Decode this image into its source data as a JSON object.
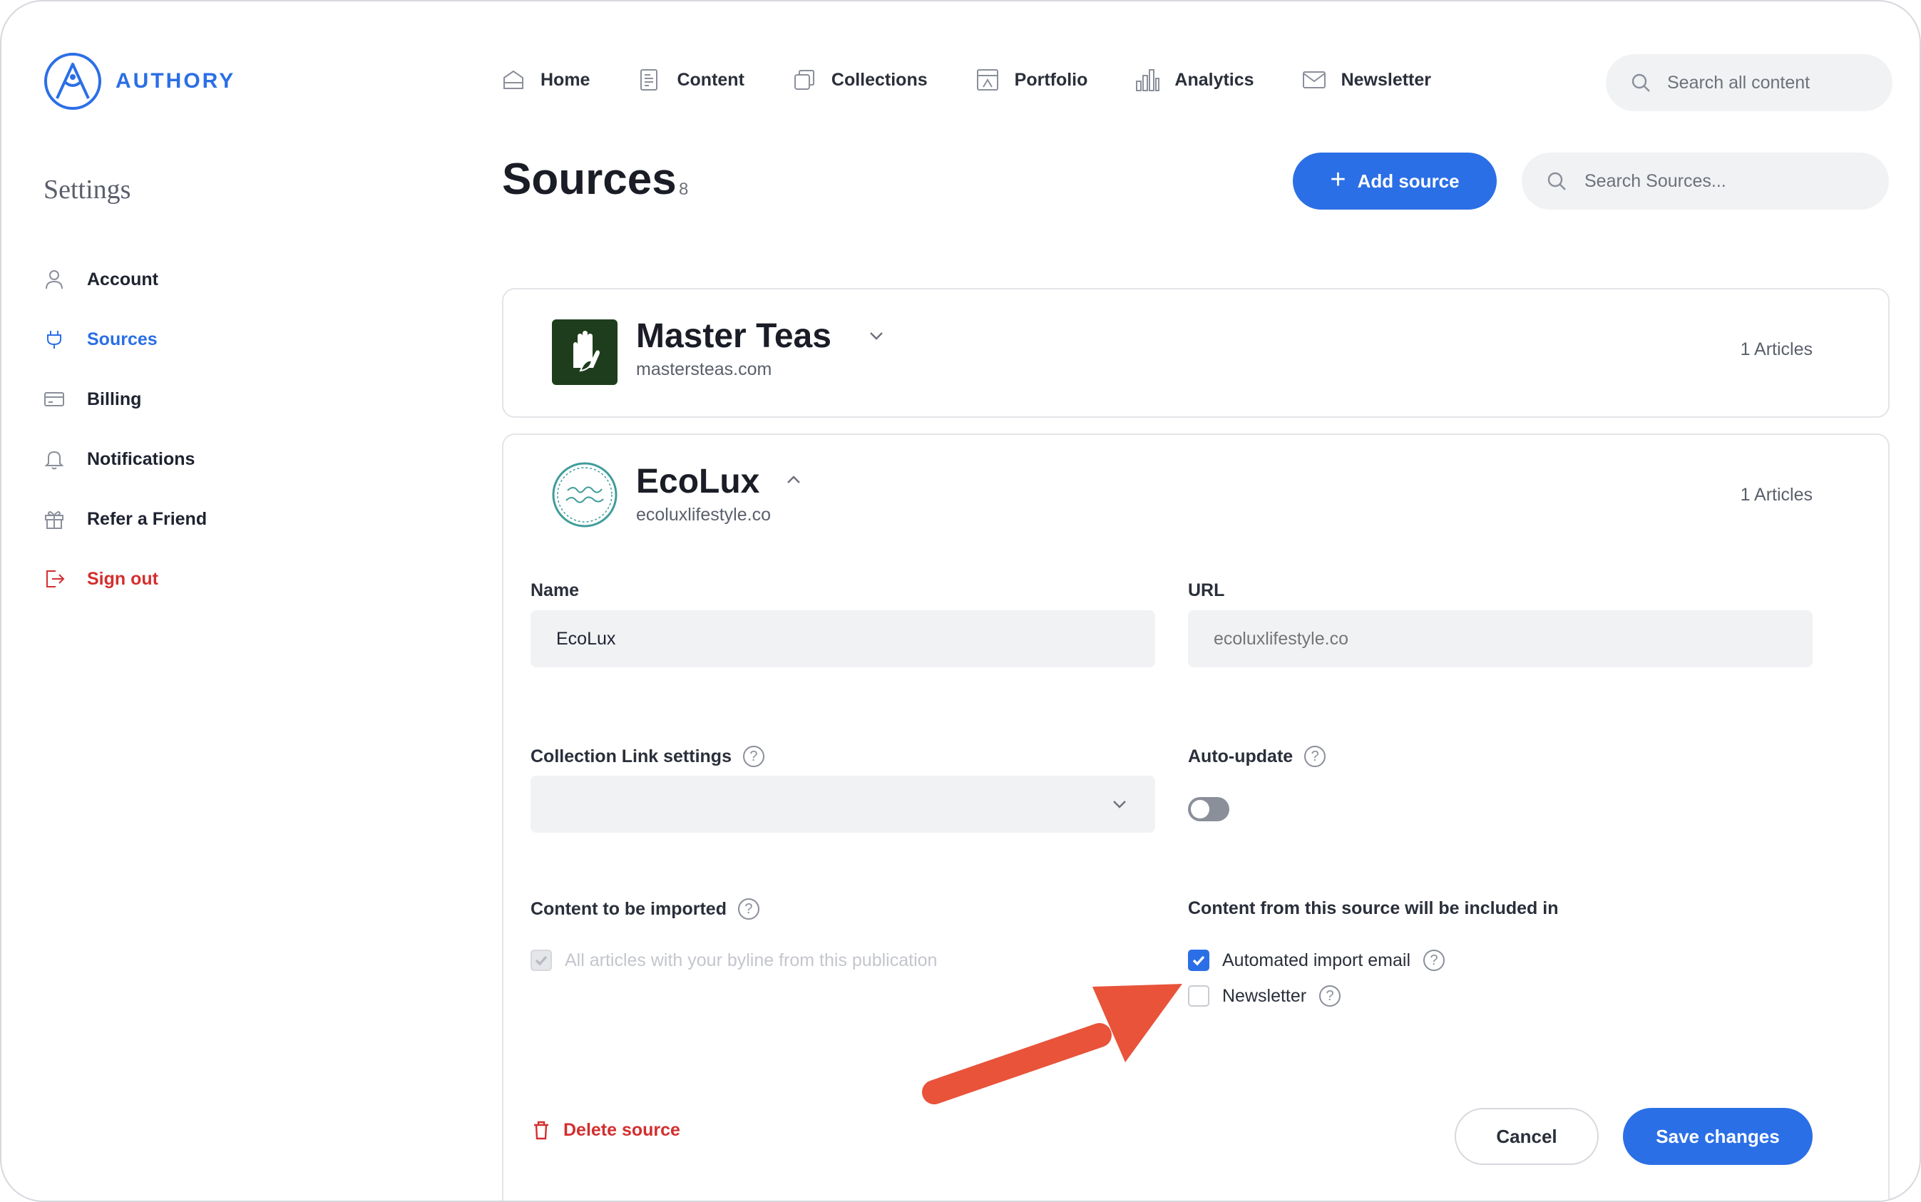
{
  "app": {
    "logo_text": "AUTHORY"
  },
  "topnav": {
    "items": [
      {
        "label": "Home",
        "icon": "home-icon"
      },
      {
        "label": "Content",
        "icon": "document-icon"
      },
      {
        "label": "Collections",
        "icon": "collections-icon"
      },
      {
        "label": "Portfolio",
        "icon": "portfolio-icon"
      },
      {
        "label": "Analytics",
        "icon": "bar-chart-icon"
      },
      {
        "label": "Newsletter",
        "icon": "mail-icon"
      }
    ],
    "search_placeholder": "Search all content"
  },
  "sidebar": {
    "title": "Settings",
    "items": [
      {
        "label": "Account",
        "icon": "user-icon",
        "state": "normal"
      },
      {
        "label": "Sources",
        "icon": "plug-icon",
        "state": "active"
      },
      {
        "label": "Billing",
        "icon": "card-icon",
        "state": "normal"
      },
      {
        "label": "Notifications",
        "icon": "bell-icon",
        "state": "normal"
      },
      {
        "label": "Refer a Friend",
        "icon": "gift-icon",
        "state": "normal"
      },
      {
        "label": "Sign out",
        "icon": "sign-out-icon",
        "state": "danger"
      }
    ]
  },
  "header": {
    "title": "Sources",
    "count": "8",
    "add_label": "Add source",
    "search_placeholder": "Search Sources..."
  },
  "sources": [
    {
      "name": "Master Teas",
      "url": "mastersteas.com",
      "articles": "1 Articles",
      "expanded": false
    },
    {
      "name": "EcoLux",
      "url": "ecoluxlifestyle.co",
      "articles": "1 Articles",
      "expanded": true
    }
  ],
  "edit_form": {
    "name_label": "Name",
    "name_value": "EcoLux",
    "url_label": "URL",
    "url_placeholder": "ecoluxlifestyle.co",
    "collection_label": "Collection Link settings",
    "collection_value": "",
    "autoupdate_label": "Auto-update",
    "autoupdate_on": false,
    "import_label": "Content to be imported",
    "import_option": "All articles with your byline from this publication",
    "included_label": "Content from this source will be included in",
    "included_options": [
      {
        "label": "Automated import email",
        "checked": true
      },
      {
        "label": "Newsletter",
        "checked": false
      }
    ],
    "delete_label": "Delete source",
    "cancel_label": "Cancel",
    "save_label": "Save changes"
  },
  "colors": {
    "accent": "#2b6fe6",
    "danger": "#d32f2f",
    "annotation_arrow": "#e8533a",
    "master_teas_logo": "#1e3d1c",
    "ecolux_logo": "#3f9d9a"
  }
}
